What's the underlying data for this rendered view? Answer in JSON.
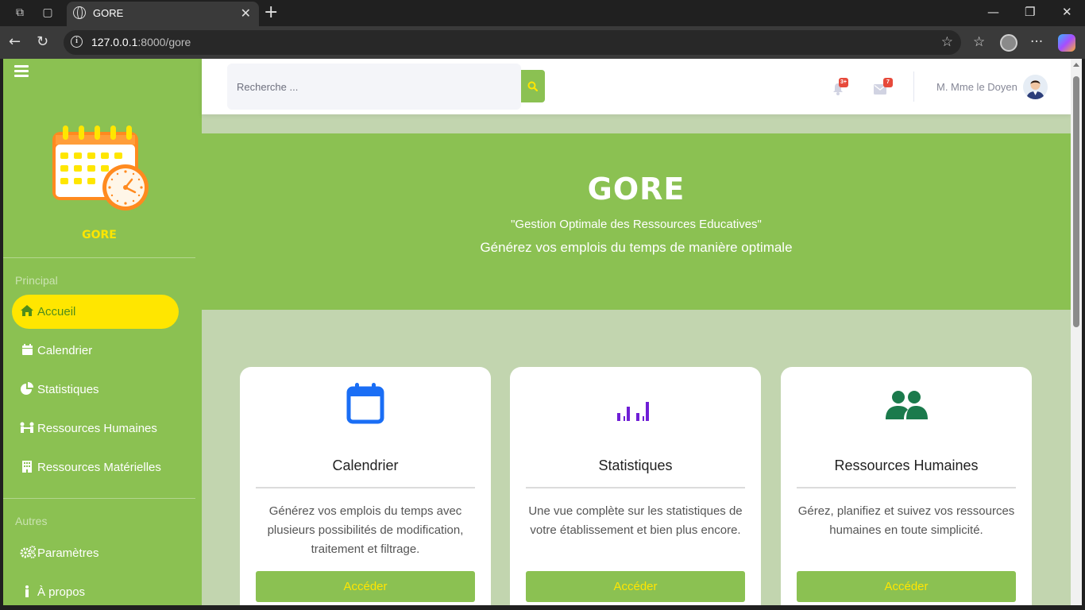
{
  "browser": {
    "tab_title": "GORE",
    "url_host": "127.0.0.1",
    "url_rest": ":8000/gore",
    "icons": [
      "workspaces-icon",
      "tab-actions-icon",
      "globe-icon",
      "close-icon",
      "new-tab-icon",
      "minimize-icon",
      "maximize-icon",
      "window-close-icon",
      "back-icon",
      "reload-icon",
      "info-icon",
      "star-icon",
      "favorites-icon",
      "profile-icon",
      "more-icon",
      "copilot-icon"
    ]
  },
  "sidebar": {
    "brand": "GORE",
    "sections": [
      {
        "heading": "Principal",
        "items": [
          {
            "label": "Accueil",
            "icon": "home-icon",
            "active": true
          },
          {
            "label": "Calendrier",
            "icon": "calendar-icon",
            "active": false
          },
          {
            "label": "Statistiques",
            "icon": "pie-chart-icon",
            "active": false
          },
          {
            "label": "Ressources Humaines",
            "icon": "people-icon",
            "active": false
          },
          {
            "label": "Ressources Matérielles",
            "icon": "building-icon",
            "active": false
          }
        ]
      },
      {
        "heading": "Autres",
        "items": [
          {
            "label": "Paramètres",
            "icon": "gears-icon",
            "active": false
          },
          {
            "label": "À propos",
            "icon": "info-icon",
            "active": false
          }
        ]
      }
    ]
  },
  "topbar": {
    "search_placeholder": "Recherche ...",
    "alerts_badge": "3+",
    "messages_badge": "7",
    "user_name": "M. Mme le Doyen"
  },
  "hero": {
    "title": "GORE",
    "subtitle": "\"Gestion Optimale des Ressources Educatives\"",
    "lead": "Générez vos emplois du temps de manière optimale"
  },
  "cards": [
    {
      "title": "Calendrier",
      "icon": "calendar-icon",
      "icon_color": "#1a6ef5",
      "text": "Générez vos emplois du temps avec plusieurs possibilités de modification, traitement et filtrage.",
      "button": "Accéder"
    },
    {
      "title": "Statistiques",
      "icon": "bar-chart-icon",
      "icon_color": "#6f1ed6",
      "text": "Une vue complète sur les statistiques de votre établissement et bien plus encore.",
      "button": "Accéder"
    },
    {
      "title": "Ressources Humaines",
      "icon": "people-icon",
      "icon_color": "#1b7a4c",
      "text": "Gérez, planifiez et suivez vos ressources humaines en toute simplicité.",
      "button": "Accéder"
    }
  ],
  "colors": {
    "sidebar_green": "#8bc152",
    "accent_yellow": "#ffe600",
    "page_bg": "#c2d5af",
    "badge_red": "#e74a3b"
  }
}
